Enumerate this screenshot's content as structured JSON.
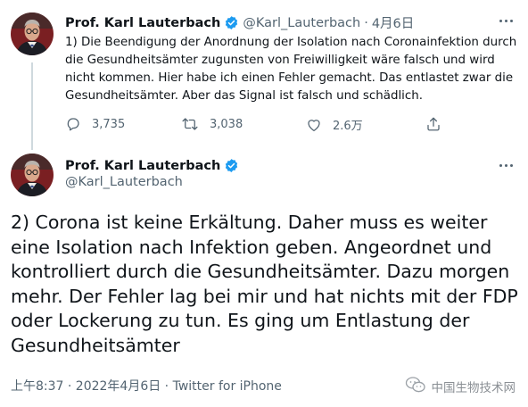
{
  "tweet1": {
    "author_name": "Prof. Karl Lauterbach",
    "handle": "@Karl_Lauterbach",
    "separator": "·",
    "date": "4月6日",
    "text": "1) Die Beendigung der Anordnung der Isolation nach Coronainfektion durch\ndie Gesundheitsämter zugunsten von Freiwilligkeit wäre falsch und wird\nnicht kommen. Hier habe ich einen Fehler gemacht. Das entlastet zwar die\nGesundheitsämter. Aber das Signal ist falsch und schädlich.",
    "replies": "3,735",
    "retweets": "3,038",
    "likes": "2.6万"
  },
  "tweet2": {
    "author_name": "Prof. Karl Lauterbach",
    "handle": "@Karl_Lauterbach",
    "text": "2) Corona ist keine Erkältung. Daher muss es weiter\neine Isolation nach Infektion geben. Angeordnet und\nkontrolliert durch die Gesundheitsämter. Dazu morgen\nmehr. Der Fehler lag bei mir und hat nichts mit der FDP\noder Lockerung zu tun. Es ging um Entlastung der\nGesundheitsämter",
    "timestamp": "上午8:37 · 2022年4月6日 · ",
    "source": "Twitter for iPhone"
  },
  "watermark": "中国生物技术网",
  "icons": {
    "verified": "verified-badge-icon",
    "more": "more-icon",
    "reply": "reply-icon",
    "retweet": "retweet-icon",
    "like": "heart-icon",
    "share": "share-icon",
    "watermark_logo": "wechat-icon"
  },
  "colors": {
    "verified_blue": "#1d9bf0",
    "text_primary": "#0f1419",
    "text_secondary": "#536471",
    "thread_line": "#cfd9de"
  }
}
